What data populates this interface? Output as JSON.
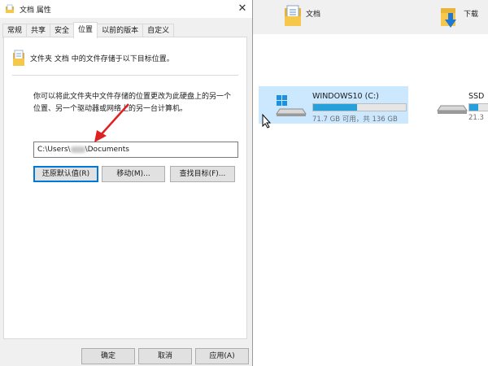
{
  "dialog": {
    "title": "文档 属性",
    "close_glyph": "✕",
    "tabs": [
      "常规",
      "共享",
      "安全",
      "位置",
      "以前的版本",
      "自定义"
    ],
    "active_tab": "位置",
    "description": "文件夹 文档 中的文件存储于以下目标位置。",
    "explanation": "你可以将此文件夹中文件存储的位置更改为此硬盘上的另一个位置、另一个驱动器或网络上的另一台计算机。",
    "path": {
      "prefix": "C:\\Users\\",
      "suffix": "\\Documents"
    },
    "buttons": {
      "restore_default": "还原默认值(R)",
      "move": "移动(M)...",
      "find_target": "查找目标(F)..."
    },
    "footer": {
      "ok": "确定",
      "cancel": "取消",
      "apply": "应用(A)"
    }
  },
  "explorer": {
    "folders": [
      {
        "label": "文档",
        "icon": "documents-folder-icon"
      },
      {
        "label": "下载",
        "icon": "downloads-folder-icon"
      }
    ],
    "drives": [
      {
        "name": "WINDOWS10 (C:)",
        "capacity": "71.7 GB 可用，共 136 GB",
        "used_fraction": 0.47,
        "selected": true,
        "icon": "windows-drive-icon"
      },
      {
        "name": "SSD",
        "capacity": "21.3",
        "used_fraction": 0.3,
        "selected": false,
        "icon": "drive-icon"
      }
    ]
  },
  "colors": {
    "accent": "#0078d7",
    "bar_fill": "#26a0da",
    "selection": "#cce8ff",
    "arrow": "#e02020"
  }
}
